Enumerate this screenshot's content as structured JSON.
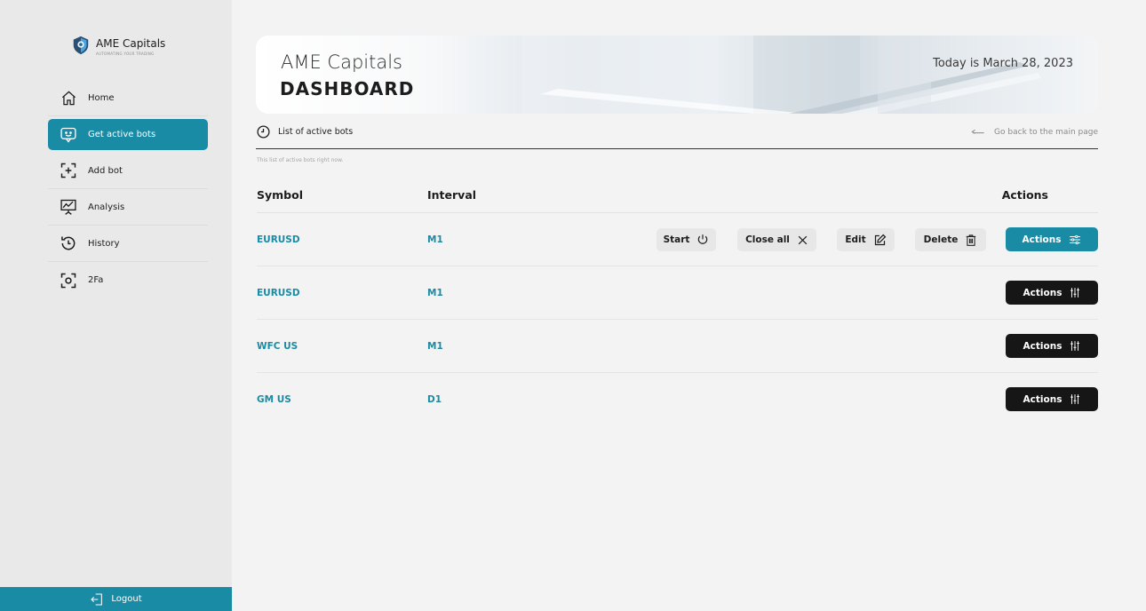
{
  "brand": {
    "name": "AME Capitals",
    "tagline": "AUTOMATING YOUR TRADING"
  },
  "sidebar": {
    "items": [
      {
        "label": "Home",
        "icon": "home-icon"
      },
      {
        "label": "Get active bots",
        "icon": "bot-chat-icon",
        "active": true
      },
      {
        "label": "Add bot",
        "icon": "add-bot-icon"
      },
      {
        "label": "Analysis",
        "icon": "analysis-chart-icon"
      },
      {
        "label": "History",
        "icon": "history-icon"
      },
      {
        "label": "2Fa",
        "icon": "scan-icon"
      }
    ],
    "logout_label": "Logout"
  },
  "banner": {
    "title": "AME Capitals",
    "subtitle": "DASHBOARD",
    "date_text": "Today is March 28, 2023"
  },
  "tabs": {
    "active_tab": "List of active bots",
    "back_link": "Go back to the main page"
  },
  "hint": "This list of active bots right now.",
  "table": {
    "headers": {
      "symbol": "Symbol",
      "interval": "Interval",
      "actions": "Actions"
    },
    "rows": [
      {
        "symbol": "EURUSD",
        "interval": "M1",
        "expanded": true
      },
      {
        "symbol": "EURUSD",
        "interval": "M1"
      },
      {
        "symbol": "WFC US",
        "interval": "M1"
      },
      {
        "symbol": "GM US",
        "interval": "D1"
      }
    ],
    "row_actions": {
      "start": "Start",
      "close_all": "Close all",
      "edit": "Edit",
      "delete": "Delete",
      "actions": "Actions"
    }
  },
  "colors": {
    "accent": "#198ba5",
    "dark_button": "#161616",
    "sidebar_bg": "#e9e9e9",
    "page_bg": "#f3f3f3"
  }
}
